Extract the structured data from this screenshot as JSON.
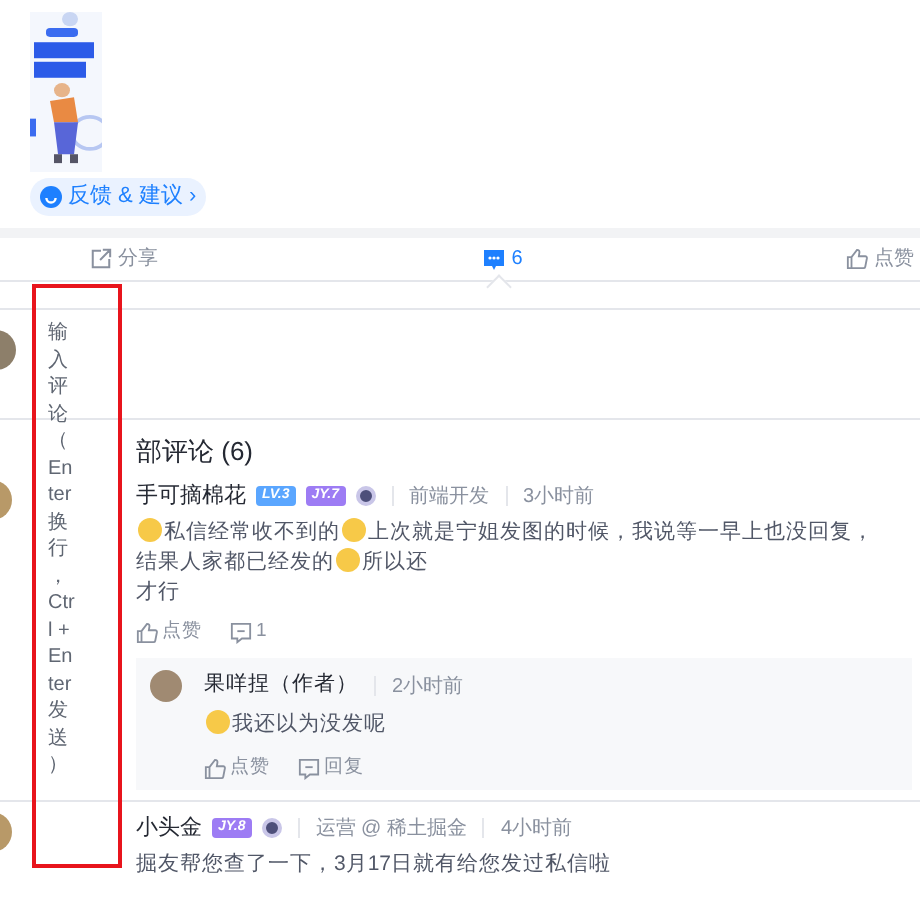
{
  "feedback_button": {
    "label": "反馈 & 建议 ›"
  },
  "action_bar": [
    {
      "kind": "share",
      "label": "分享",
      "selected": false
    },
    {
      "kind": "comment",
      "label": "6",
      "selected": true
    },
    {
      "kind": "like",
      "label": "点赞",
      "selected": false
    }
  ],
  "comment_input": {
    "placeholder": "输入评论（Enter换行，Ctrl + Enter发送）"
  },
  "comments_heading": "部评论 (6)",
  "comments": [
    {
      "author": "手可摘棉花",
      "badges": [
        {
          "kind": "level",
          "text": "LV.3"
        },
        {
          "kind": "jy",
          "text": "JY.7"
        },
        {
          "kind": "medal"
        }
      ],
      "meta": [
        "前端开发",
        "3小时前"
      ],
      "lines": [
        [
          {
            "kind": "emoji"
          },
          {
            "kind": "text",
            "text": "私信经常收不到的"
          },
          {
            "kind": "emoji"
          },
          {
            "kind": "text",
            "text": "上次就是宁姐发图的时候，我说等一早上也没回复，"
          },
          {
            "kind": "text",
            "text": "结果人家都已经发的"
          },
          {
            "kind": "emoji"
          },
          {
            "kind": "text",
            "text": "所以还"
          }
        ],
        [
          {
            "kind": "text",
            "text": "才行"
          }
        ]
      ],
      "actions": [
        {
          "kind": "like",
          "label": "点赞"
        },
        {
          "kind": "reply",
          "label": "1"
        }
      ],
      "replies": [
        {
          "author": "果咩捏（作者）",
          "meta": [
            "2小时前"
          ],
          "lines": [
            [
              {
                "kind": "emoji"
              },
              {
                "kind": "text",
                "text": "我还以为没发呢"
              }
            ]
          ],
          "actions": [
            {
              "kind": "like",
              "label": "点赞"
            },
            {
              "kind": "reply",
              "label": "回复"
            }
          ]
        }
      ]
    },
    {
      "author": "小头金",
      "badges": [
        {
          "kind": "jy",
          "text": "JY.8"
        },
        {
          "kind": "medal"
        }
      ],
      "meta": [
        "运营 @ 稀土掘金",
        "4小时前"
      ],
      "lines": [
        [
          {
            "kind": "text",
            "text": "掘友帮您查了一下，3月17日就有给您发过私信啦"
          }
        ]
      ]
    }
  ]
}
